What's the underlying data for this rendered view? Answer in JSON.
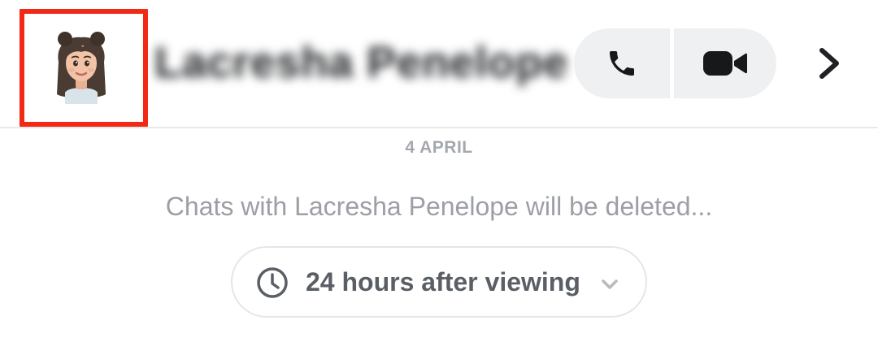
{
  "header": {
    "avatar_icon": "bitmoji-avatar",
    "contact_name": "Lacresha Penelope",
    "call_icon": "phone-icon",
    "video_icon": "video-camera-icon",
    "more_icon": "chevron-right-icon",
    "highlight_color": "#f22a15"
  },
  "chat": {
    "date_label": "4 APRIL",
    "notice": "Chats with Lacresha Penelope will be deleted...",
    "duration_option": {
      "icon": "clock-icon",
      "label": "24 hours after viewing",
      "dropdown_icon": "chevron-down-icon"
    }
  },
  "colors": {
    "button_bg": "#eef0f2",
    "text_muted": "#9c9fa5",
    "text_primary": "#1f2124"
  }
}
